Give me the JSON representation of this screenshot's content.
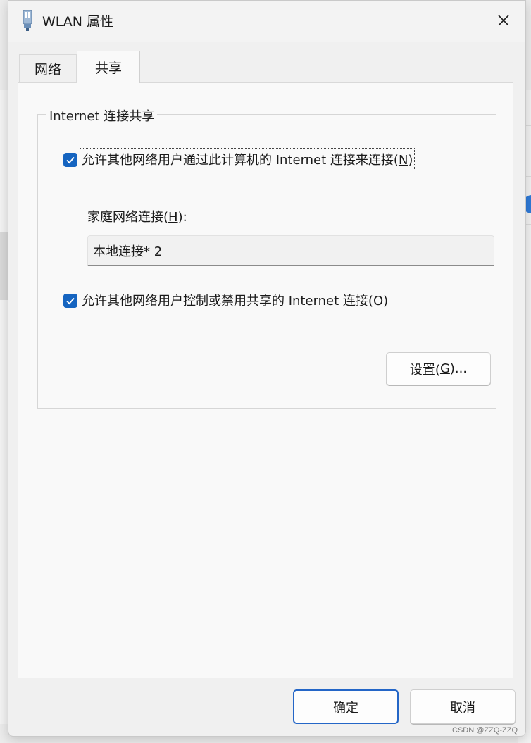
{
  "window": {
    "title": "WLAN 属性",
    "icon": "wifi-adapter-icon"
  },
  "tabs": [
    {
      "label": "网络",
      "selected": false
    },
    {
      "label": "共享",
      "selected": true
    }
  ],
  "ics_group": {
    "legend": "Internet 连接共享",
    "allow_share": {
      "label": "允许其他网络用户通过此计算机的 Internet 连接来连接(",
      "mnemonic": "N",
      "suffix": ")",
      "checked": true
    },
    "home_network": {
      "label": "家庭网络连接(",
      "mnemonic": "H",
      "suffix": "):",
      "value": "本地连接* 2"
    },
    "allow_control": {
      "label": "允许其他网络用户控制或禁用共享的 Internet 连接(",
      "mnemonic": "O",
      "suffix": ")",
      "checked": true
    },
    "settings_button": {
      "label": "设置(",
      "mnemonic": "G",
      "suffix": ")..."
    }
  },
  "footer": {
    "ok_label": "确定",
    "cancel_label": "取消"
  },
  "watermark": "CSDN @ZZQ-ZZQ",
  "colors": {
    "accent": "#1564c0",
    "default_button_border": "#2466c7"
  }
}
